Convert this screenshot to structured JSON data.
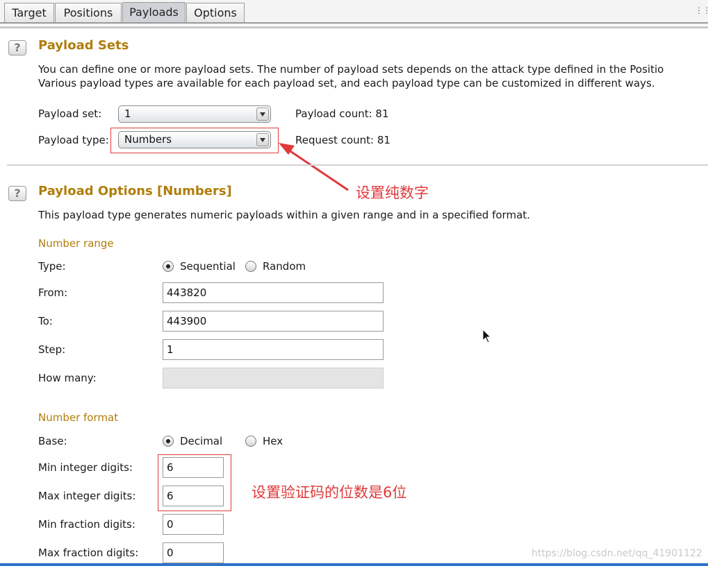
{
  "tabs": [
    {
      "label": "Target",
      "active": false
    },
    {
      "label": "Positions",
      "active": false
    },
    {
      "label": "Payloads",
      "active": true
    },
    {
      "label": "Options",
      "active": false
    }
  ],
  "payload_sets": {
    "title": "Payload Sets",
    "desc_line1": "You can define one or more payload sets. The number of payload sets depends on the attack type defined in the Positio",
    "desc_line2": "Various payload types are available for each payload set, and each payload type can be customized in different ways.",
    "payload_set_label": "Payload set:",
    "payload_set_value": "1",
    "payload_type_label": "Payload type:",
    "payload_type_value": "Numbers",
    "payload_count_label": "Payload count:  81",
    "request_count_label": "Request count:  81"
  },
  "payload_options": {
    "title": "Payload Options [Numbers]",
    "desc": "This payload type generates numeric payloads within a given range and in a specified format.",
    "number_range": {
      "heading": "Number range",
      "type_label": "Type:",
      "type_options": [
        "Sequential",
        "Random"
      ],
      "type_selected": "Sequential",
      "from_label": "From:",
      "from_value": "443820",
      "to_label": "To:",
      "to_value": "443900",
      "step_label": "Step:",
      "step_value": "1",
      "how_many_label": "How many:",
      "how_many_value": ""
    },
    "number_format": {
      "heading": "Number format",
      "base_label": "Base:",
      "base_options": [
        "Decimal",
        "Hex"
      ],
      "base_selected": "Decimal",
      "min_int_label": "Min integer digits:",
      "min_int_value": "6",
      "max_int_label": "Max integer digits:",
      "max_int_value": "6",
      "min_frac_label": "Min fraction digits:",
      "min_frac_value": "0",
      "max_frac_label": "Max fraction digits:",
      "max_frac_value": "0"
    }
  },
  "annotations": {
    "pure_numbers": "设置纯数字",
    "digits": "设置验证码的位数是6位",
    "color": "#e0393a"
  },
  "watermark": "https://blog.csdn.net/qq_41901122",
  "colors": {
    "section_title": "#b07d0a",
    "accent_blue": "#2f73c9"
  }
}
